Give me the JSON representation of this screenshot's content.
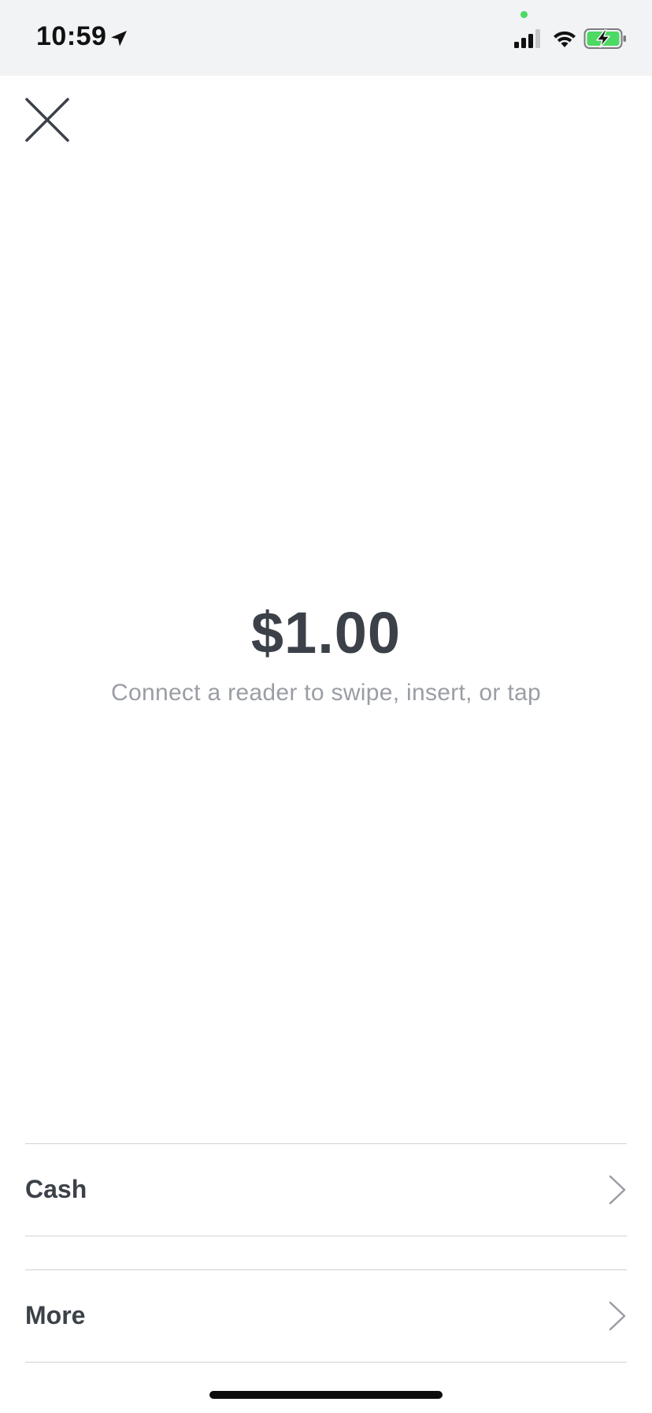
{
  "status_bar": {
    "time": "10:59",
    "icons": [
      "location-arrow-icon",
      "signal-icon",
      "wifi-icon",
      "battery-charging-icon"
    ],
    "privacy_dot_color": "#4cd964",
    "battery_color": "#4cd964"
  },
  "header": {
    "close_icon": "close-icon"
  },
  "payment": {
    "amount": "$1.00",
    "instruction": "Connect a reader to swipe, insert, or tap"
  },
  "options": [
    {
      "label": "Cash",
      "icon": "chevron-right-icon"
    },
    {
      "label": "More",
      "icon": "chevron-right-icon"
    }
  ],
  "colors": {
    "primary_text": "#3c4149",
    "secondary_text": "#9a9ea4",
    "divider": "#cfd1d4",
    "status_bar_bg": "#f2f3f5"
  }
}
